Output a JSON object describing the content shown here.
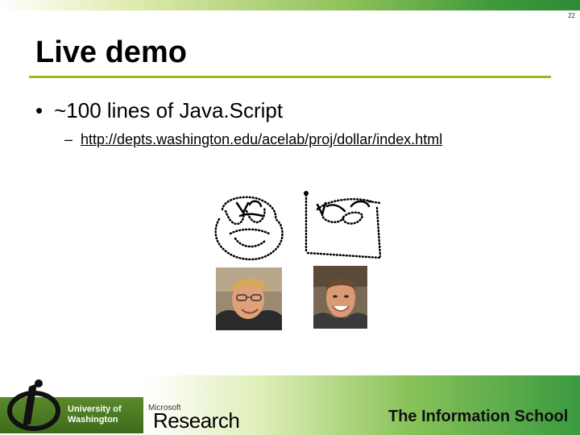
{
  "slide": {
    "page_number": "22",
    "title": "Live demo",
    "bullet": "~100 lines of Java.Script",
    "bullet_marker": "•",
    "sub_marker": "–",
    "sub_bullet_link": "http://depts.washington.edu/acelab/proj/dollar/index.html"
  },
  "footer": {
    "uw_line1": "University of",
    "uw_line2": "Washington",
    "ms_small": "Microsoft",
    "ms_research": "Research",
    "ischool": "The Information School"
  },
  "colors": {
    "title_rule": "#99bb22",
    "uw_band": "#4b7a22",
    "footer_green": "#3a9a3f"
  }
}
